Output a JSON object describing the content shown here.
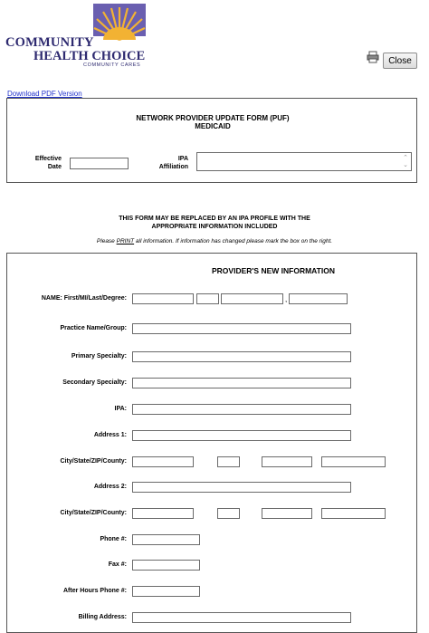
{
  "header": {
    "logo_line1": "COMMUNITY",
    "logo_line2": "HEALTH CHOICE",
    "logo_tagline": "COMMUNITY CARES",
    "close_label": "Close",
    "download_pdf": "Download PDF Version",
    "brand_colors": {
      "navy": "#2e2a70",
      "gold": "#f2b233",
      "purple": "#6a5fb0"
    }
  },
  "form": {
    "title_line1": "NETWORK PROVIDER UPDATE FORM (PUF)",
    "title_line2": "MEDICAID",
    "effective_date_label_1": "Effective",
    "effective_date_label_2": "Date",
    "effective_date_value": "",
    "ipa_label_1": "IPA",
    "ipa_label_2": "Affiliation",
    "ipa_value": ""
  },
  "notice": {
    "line1": "THIS FORM MAY BE REPLACED BY AN IPA PROFILE WITH THE",
    "line2": "APPROPRIATE INFORMATION INCLUDED",
    "instruction_pre": "Please ",
    "instruction_print": "PRINT",
    "instruction_post": " all information. If information has changed please mark the box on the right."
  },
  "providers_new_info": {
    "section_title": "PROVIDER'S NEW INFORMATION",
    "name_label": "NAME: First/MI/Last/Degree:",
    "name_comma": ",",
    "practice_label": "Practice Name/Group:",
    "primary_label": "Primary Specialty:",
    "secondary_label": "Secondary Specialty:",
    "ipa_label": "IPA:",
    "address1_label": "Address 1:",
    "csz1_label": "City/State/ZIP/County:",
    "address2_label": "Address 2:",
    "csz2_label": "City/State/ZIP/County:",
    "phone_label": "Phone #:",
    "fax_label": "Fax #:",
    "after_hours_label": "After Hours Phone #:",
    "billing_label": "Billing Address:"
  }
}
